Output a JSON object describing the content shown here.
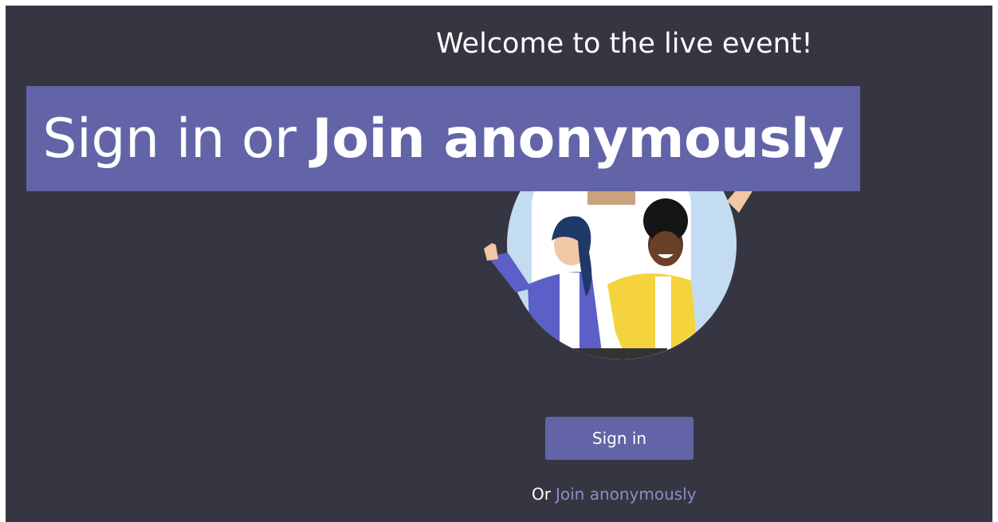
{
  "page": {
    "welcome": "Welcome to the live event!",
    "background_color": "#363642"
  },
  "banner": {
    "light_text": "Sign in or",
    "bold_text": "Join anonymously",
    "color": "#6264a7"
  },
  "hero": {
    "illustration": "people-waving-illustration",
    "circle_color": "#c4dcf2"
  },
  "actions": {
    "signin_label": "Sign in",
    "or_text": "Or",
    "join_label": "Join anonymously",
    "accent": "#6264a7"
  }
}
